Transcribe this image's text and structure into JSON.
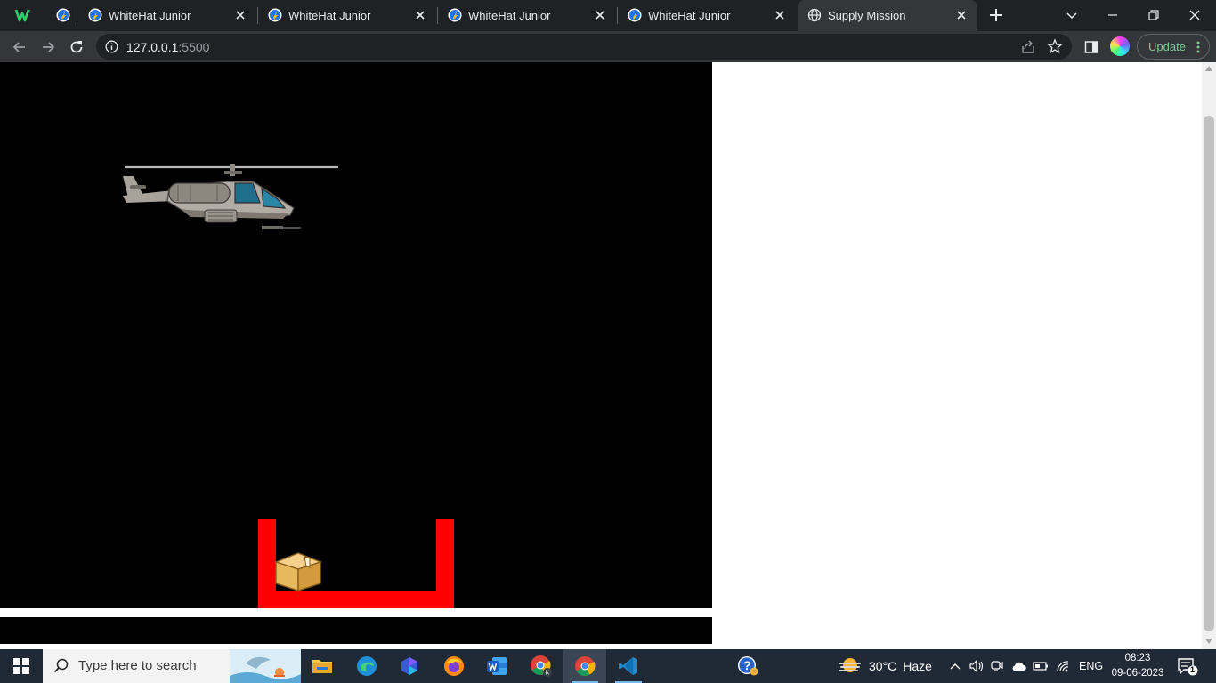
{
  "browser": {
    "tabs": [
      {
        "title": "",
        "favicon": "whitehat-w-logo"
      },
      {
        "title": "",
        "favicon": "whitehat-rocket-icon"
      },
      {
        "title": "WhiteHat Junior",
        "favicon": "whitehat-rocket-icon"
      },
      {
        "title": "WhiteHat Junior",
        "favicon": "whitehat-rocket-icon"
      },
      {
        "title": "WhiteHat Junior",
        "favicon": "whitehat-rocket-icon"
      },
      {
        "title": "WhiteHat Junior",
        "favicon": "whitehat-rocket-icon"
      },
      {
        "title": "Supply Mission",
        "favicon": "globe-icon",
        "active": true
      }
    ],
    "address": {
      "host": "127.0.0.1",
      "port": ":5500"
    },
    "update_label": "Update"
  },
  "game": {
    "title": "Supply Mission",
    "sprites": [
      "helicopter",
      "package-box",
      "red-drop-zone"
    ],
    "colors": {
      "background": "#000000",
      "zone": "#ff0000",
      "package": "#e8b85c"
    }
  },
  "taskbar": {
    "search_placeholder": "Type here to search",
    "weather": {
      "temp": "30°C",
      "condition": "Haze"
    },
    "language": "ENG",
    "time": "08:23",
    "date": "09-06-2023",
    "notification_count": "1"
  }
}
